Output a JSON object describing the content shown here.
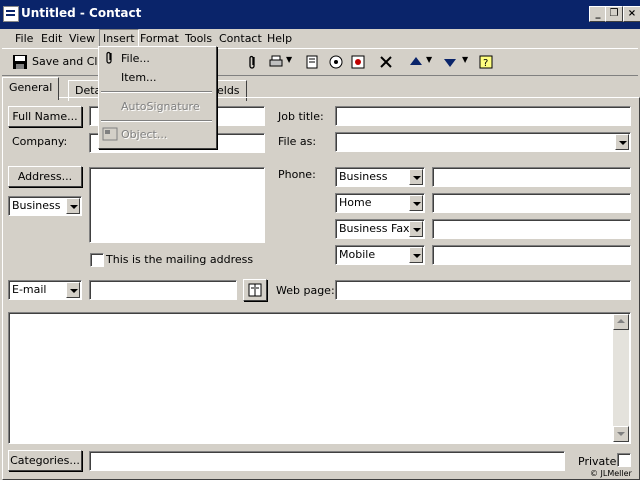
{
  "window": {
    "title": "Untitled - Contact"
  },
  "menubar": {
    "items": [
      "File",
      "Edit",
      "View",
      "Insert",
      "Format",
      "Tools",
      "Contact",
      "Help"
    ]
  },
  "toolbar": {
    "save_close": "Save and Close"
  },
  "insert_menu": {
    "items": [
      "File...",
      "Item...",
      "AutoSignature",
      "Object..."
    ]
  },
  "tabs": [
    "General",
    "Deta",
    "elds"
  ],
  "form": {
    "full_name_button": "Full Name...",
    "company_label": "Company:",
    "job_title_label": "Job title:",
    "file_as_label": "File as:",
    "address_button": "Address...",
    "address_type": "Business",
    "mailing_checkbox": "This is the mailing address",
    "phone_label": "Phone:",
    "phone_types": [
      "Business",
      "Home",
      "Business Fax",
      "Mobile"
    ],
    "email_type": "E-mail",
    "web_page_label": "Web page:",
    "categories_button": "Categories...",
    "private_label": "Private"
  },
  "watermark": "© JLMeller",
  "icons": [
    "save-icon",
    "paperclip-icon",
    "print-icon",
    "delete-icon",
    "up-arrow-icon",
    "down-arrow-icon",
    "address-book-icon"
  ]
}
